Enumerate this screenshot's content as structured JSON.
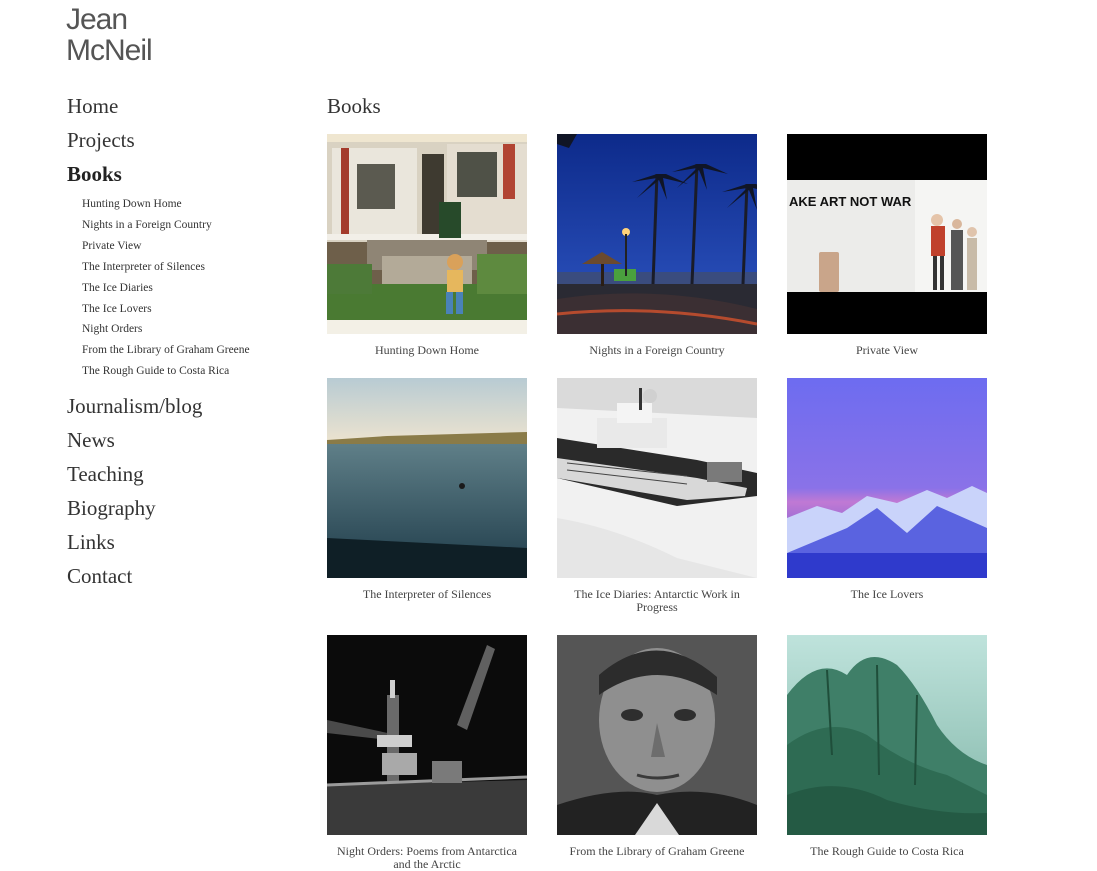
{
  "site": {
    "title_line1": "Jean",
    "title_line2": "McNeil"
  },
  "nav": {
    "items": [
      {
        "label": "Home"
      },
      {
        "label": "Projects"
      },
      {
        "label": "Books"
      },
      {
        "label": "Journalism/blog"
      },
      {
        "label": "News"
      },
      {
        "label": "Teaching"
      },
      {
        "label": "Biography"
      },
      {
        "label": "Links"
      },
      {
        "label": "Contact"
      }
    ],
    "active": "Books",
    "books_sub": [
      {
        "label": "Hunting Down Home"
      },
      {
        "label": "Nights in a Foreign Country"
      },
      {
        "label": "Private View"
      },
      {
        "label": "The Interpreter of Silences"
      },
      {
        "label": "The Ice Diaries"
      },
      {
        "label": "The Ice Lovers"
      },
      {
        "label": "Night Orders"
      },
      {
        "label": "From the Library of Graham Greene"
      },
      {
        "label": "The Rough Guide to Costa Rica"
      }
    ]
  },
  "main": {
    "title": "Books",
    "books": [
      {
        "caption": "Hunting Down Home"
      },
      {
        "caption": "Nights in a Foreign Country"
      },
      {
        "caption": "Private View",
        "image_text": "AKE ART NOT WAR"
      },
      {
        "caption": "The Interpreter of Silences"
      },
      {
        "caption": "The Ice Diaries: Antarctic Work in Progress"
      },
      {
        "caption": "The Ice Lovers"
      },
      {
        "caption": "Night Orders: Poems from Antarctica and the Arctic"
      },
      {
        "caption": "From the Library of Graham Greene"
      },
      {
        "caption": "The Rough Guide to Costa Rica"
      }
    ]
  }
}
